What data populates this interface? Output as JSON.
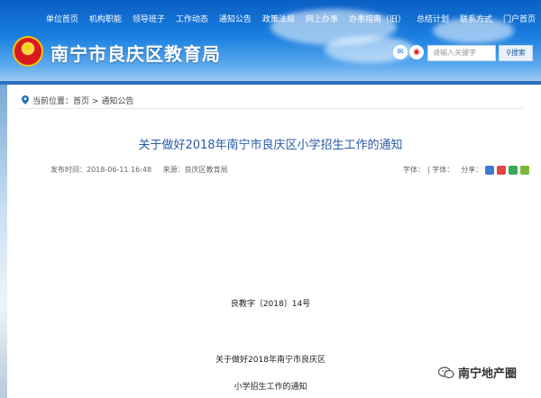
{
  "header": {
    "nav": [
      "单位首页",
      "机构职能",
      "领导班子",
      "工作动态",
      "通知公告",
      "政策法规",
      "网上办事",
      "办事指南（旧）",
      "总结计划",
      "联系方式",
      "门户首页"
    ],
    "site_name": "南宁市良庆区教育局",
    "search_placeholder": "请输入关键字",
    "search_button": "搜索"
  },
  "breadcrumb": {
    "label": "当前位置：",
    "home": "首页",
    "sep": ">",
    "current": "通知公告"
  },
  "article": {
    "title": "关于做好2018年南宁市良庆区小学招生工作的通知",
    "publish_time": "发布时间：2018-06-11 16:48",
    "source": "来源：良庆区教育局",
    "font_large": "字体：",
    "font_small": "| 字体：",
    "share_label": "分享：",
    "doc_number": "良教字〔2018〕14号",
    "subtitle_line1": "关于做好2018年南宁市良庆区",
    "subtitle_line2": "小学招生工作的通知"
  },
  "watermark": {
    "text": "南宁地产圈"
  },
  "colors": {
    "banner": "#1a7fe0",
    "title": "#2a5aa8",
    "accent_bar": "#2b6fbf"
  },
  "icons": [
    "national-emblem-icon",
    "wechat-icon",
    "weibo-icon",
    "search-icon",
    "location-pin-icon",
    "share-icons",
    "wechat-watermark-icon"
  ]
}
